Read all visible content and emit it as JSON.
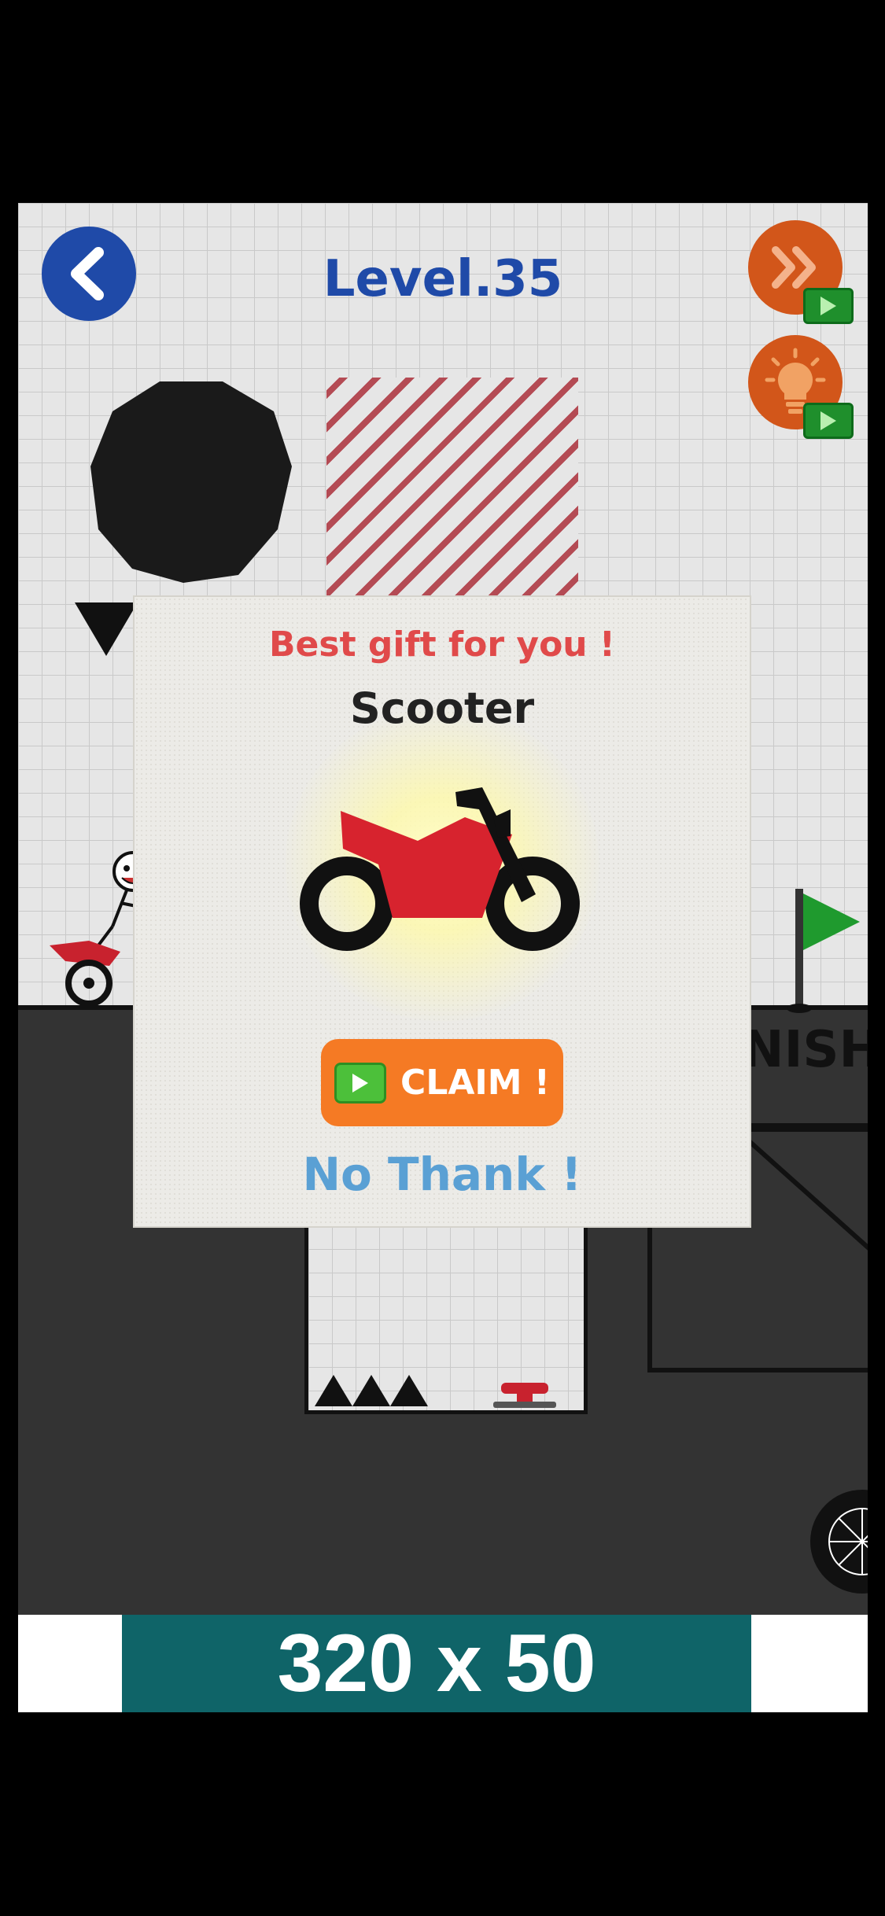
{
  "level": {
    "title": "Level.35"
  },
  "hud": {
    "back_icon": "chevron-left-icon",
    "skip_icon": "double-chevron-right-icon",
    "hint_icon": "lightbulb-icon",
    "video_icon": "play-icon"
  },
  "scene": {
    "finish_label": "NISH"
  },
  "gift_dialog": {
    "subtitle": "Best gift for you !",
    "item_name": "Scooter",
    "claim_label": "CLAIM !",
    "decline_label": "No Thank !"
  },
  "ad": {
    "label": "320 x 50"
  },
  "colors": {
    "accent_blue": "#1f4aa8",
    "accent_orange": "#d2561a",
    "claim_orange": "#f57a24",
    "gift_red": "#e04a4a",
    "decline_blue": "#5aa0d4",
    "ad_teal": "#0f6468"
  }
}
